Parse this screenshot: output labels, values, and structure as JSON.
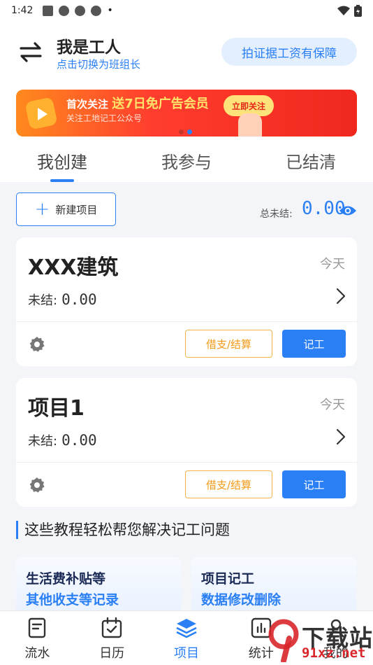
{
  "status_bar": {
    "time": "1:42",
    "dot": "•"
  },
  "header": {
    "role_title": "我是工人",
    "role_subtitle": "点击切换为班组长",
    "guarantee_button": "拍证据工资有保障"
  },
  "banner": {
    "line1_prefix": "首次关注",
    "line1_highlight": "送7日免广告会员",
    "line2": "关注工地记工公众号",
    "button": "立即关注"
  },
  "tabs": [
    {
      "label": "我创建",
      "active": true
    },
    {
      "label": "我参与",
      "active": false
    },
    {
      "label": "已结清",
      "active": false
    }
  ],
  "toolbar": {
    "new_project": "新建项目",
    "total_label": "总未结:",
    "total_value": "0.00"
  },
  "projects": [
    {
      "name": "XXX建筑",
      "date": "今天",
      "pending_label": "未结:",
      "pending_value": "0.00",
      "loan_button": "借支/结算",
      "record_button": "记工"
    },
    {
      "name": "项目1",
      "date": "今天",
      "pending_label": "未结:",
      "pending_value": "0.00",
      "loan_button": "借支/结算",
      "record_button": "记工"
    }
  ],
  "tutorials": {
    "heading": "这些教程轻松帮您解决记工问题",
    "cards": [
      {
        "line1": "生活费补贴等",
        "line2": "其他收支等记录"
      },
      {
        "line1": "项目记工",
        "line2": "数据修改删除"
      }
    ]
  },
  "bottom_nav": [
    {
      "label": "流水",
      "icon": "document-icon",
      "active": false
    },
    {
      "label": "日历",
      "icon": "calendar-icon",
      "active": false
    },
    {
      "label": "项目",
      "icon": "layers-icon",
      "active": true
    },
    {
      "label": "统计",
      "icon": "chart-icon",
      "active": false
    },
    {
      "label": "我的",
      "icon": "user-icon",
      "active": false
    }
  ],
  "watermark": {
    "brand": "下载站",
    "domain": "91xz.net"
  },
  "colors": {
    "accent": "#2a7ff5",
    "warning": "#f39a19",
    "banner_red": "#f0271d"
  }
}
